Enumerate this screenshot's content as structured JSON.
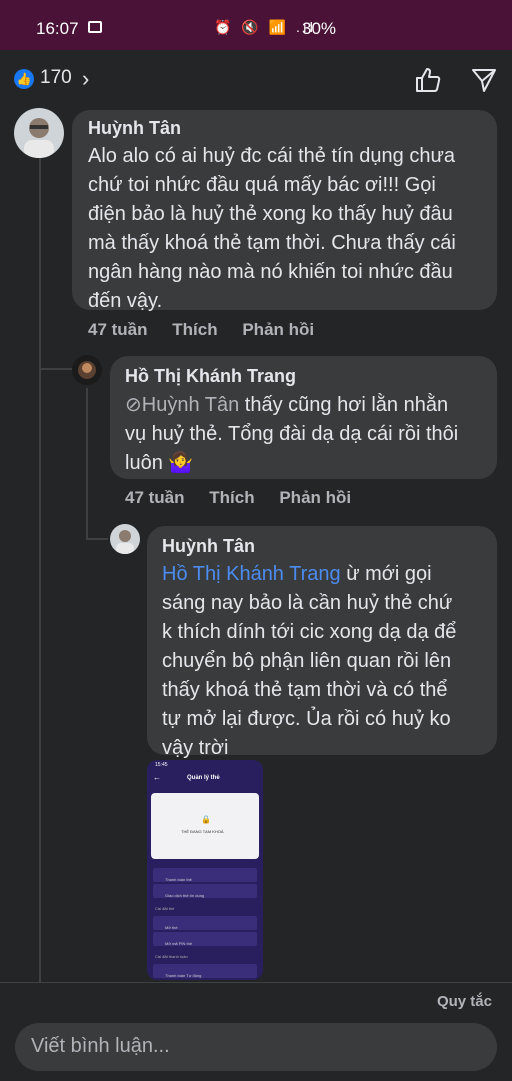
{
  "status": {
    "time": "16:07",
    "icons": "⏰ 🔇 📶 .ıl",
    "battery": "30%"
  },
  "header": {
    "like_count": "170",
    "like_icon": "thumbs-up-icon"
  },
  "comments": [
    {
      "author": "Huỳnh Tân",
      "lines": [
        "Alo alo có ai huỷ đc cái thẻ tín dụng chưa",
        "chứ toi nhức đầu quá mấy bác ơi!!! Gọi",
        "điện bảo là huỷ thẻ xong ko thấy huỷ đâu",
        "mà thấy khoá thẻ tạm thời. Chưa thấy cái",
        "ngân hàng nào mà nó khiến toi nhức đầu",
        "đến vậy."
      ],
      "time": "47 tuần",
      "like": "Thích",
      "reply": "Phản hồi"
    },
    {
      "author": "Hồ Thị Khánh Trang",
      "mention": "Huỳnh Tân",
      "line1_rest": " thấy cũng hơi lằn nhằn",
      "line2": "vụ huỷ thẻ. Tổng đài dạ dạ cái rồi thôi",
      "line3": "luôn 🤷‍♀️",
      "time": "47 tuần",
      "like": "Thích",
      "reply": "Phản hồi"
    },
    {
      "author": "Huỳnh Tân",
      "mention": "Hồ Thị Khánh Trang",
      "line1_rest": " ừ mới gọi",
      "lines": [
        "sáng nay bảo là cần huỷ thẻ chứ",
        "k thích dính tới cic xong dạ dạ để",
        "chuyển bộ phận liên quan rồi lên",
        "thấy khoá thẻ tạm thời và có thể",
        "tự mở lại được. Ủa rồi có huỷ ko",
        "vậy trời"
      ]
    }
  ],
  "attachment": {
    "status_time": "15:45",
    "title": "Quản lý thẻ",
    "card_label": "THẺ ĐANG TẠM KHOÁ",
    "menu": [
      "Thanh toán thẻ",
      "Giao dịch thẻ tín dụng",
      "Cài đặt thẻ",
      "Mở thẻ",
      "Mở mã PIN thẻ",
      "Cài đặt thanh toán",
      "Thanh toán Tự động"
    ]
  },
  "footer": {
    "rules": "Quy tắc",
    "input_placeholder": "Viết bình luận..."
  }
}
